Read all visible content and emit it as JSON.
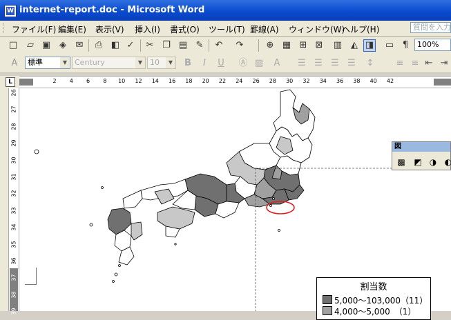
{
  "window": {
    "title": "internet-report.doc - Microsoft Word"
  },
  "menu": {
    "items": [
      "ファイル(F)",
      "編集(E)",
      "表示(V)",
      "挿入(I)",
      "書式(O)",
      "ツール(T)",
      "罫線(A)",
      "ウィンドウ(W)",
      "ヘルプ(H)"
    ],
    "help_placeholder": "質問を入力"
  },
  "toolbar": {
    "zoom": "100%",
    "style": "標準",
    "font": "Century",
    "size": "10"
  },
  "ruler": {
    "h_ticks": [
      "2",
      "4",
      "6",
      "8",
      "10",
      "12",
      "14",
      "16",
      "18",
      "20",
      "22",
      "24",
      "26",
      "28",
      "30",
      "32",
      "34",
      "36",
      "38",
      "40",
      "42",
      "44"
    ],
    "v_ticks": [
      "26",
      "27",
      "28",
      "29",
      "30",
      "31",
      "32",
      "33",
      "34",
      "35",
      "36",
      "37",
      "38",
      "39"
    ]
  },
  "float_toolbar": {
    "title": "図"
  },
  "legend": {
    "title": "割当数",
    "rows": [
      {
        "label": "5,000～103,000（11）",
        "color": "#707070"
      },
      {
        "label": "4,000～5,000　（1）",
        "color": "#a0a0a0"
      }
    ]
  },
  "colors": {
    "titlebar": "#0a4bd0",
    "highlight_ellipse": "#e02020"
  }
}
